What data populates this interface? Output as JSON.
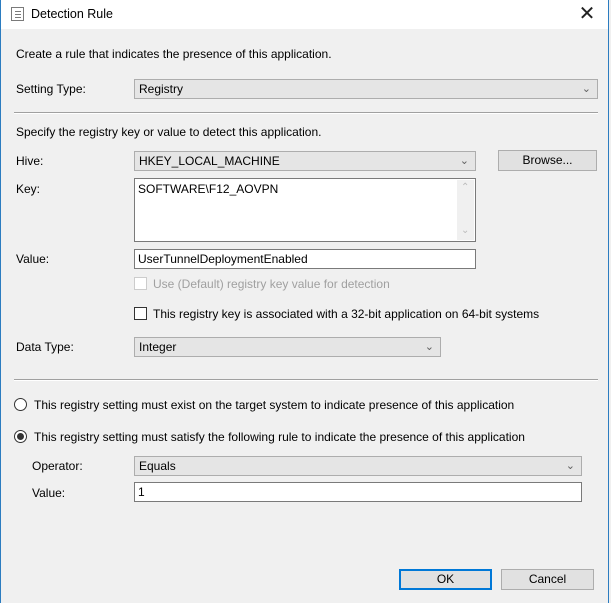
{
  "window": {
    "title": "Detection Rule",
    "icon": "document-list-icon",
    "close_label": "✕"
  },
  "intro_text": "Create a rule that indicates the presence of this application.",
  "setting_type": {
    "label": "Setting Type:",
    "value": "Registry"
  },
  "registry_section": {
    "heading": "Specify the registry key or value to detect this application.",
    "hive": {
      "label": "Hive:",
      "value": "HKEY_LOCAL_MACHINE"
    },
    "browse_label": "Browse...",
    "key": {
      "label": "Key:",
      "value": "SOFTWARE\\F12_AOVPN"
    },
    "value": {
      "label": "Value:",
      "value": "UserTunnelDeploymentEnabled"
    },
    "use_default": {
      "label": "Use (Default) registry key value for detection",
      "checked": false,
      "enabled": false
    },
    "is_32bit": {
      "label": "This registry key is associated with a 32-bit application on 64-bit systems",
      "checked": false
    },
    "data_type": {
      "label": "Data Type:",
      "value": "Integer"
    }
  },
  "rule_options": {
    "must_exist": {
      "label": "This registry setting must exist on the target system to indicate presence of this application",
      "selected": false
    },
    "must_satisfy": {
      "label": "This registry setting must satisfy the following rule to indicate the presence of this application",
      "selected": true
    },
    "operator": {
      "label": "Operator:",
      "value": "Equals"
    },
    "value": {
      "label": "Value:",
      "value": "1"
    }
  },
  "buttons": {
    "ok": "OK",
    "cancel": "Cancel"
  },
  "icons": {
    "chevron": "⌄",
    "scroll_up": "⌃",
    "scroll_down": "⌄"
  }
}
